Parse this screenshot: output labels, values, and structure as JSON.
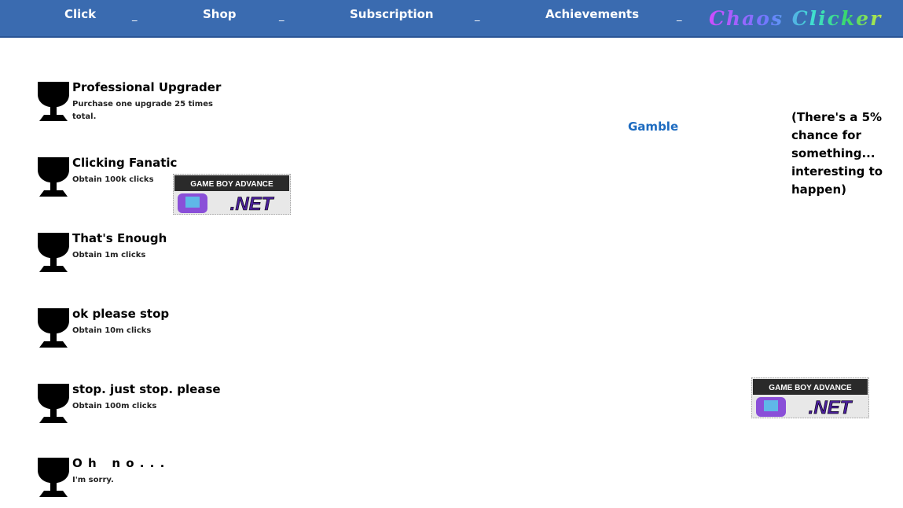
{
  "nav": {
    "click": "Click",
    "shop": "Shop",
    "subscription": "Subscription",
    "achievements": "Achievements",
    "separator": "_",
    "brand": "Chaos Clicker"
  },
  "achievements": [
    {
      "title": "Professional Upgrader",
      "desc": "Purchase one upgrade 25 times total."
    },
    {
      "title": "Clicking Fanatic",
      "desc": "Obtain 100k clicks"
    },
    {
      "title": "That's Enough",
      "desc": "Obtain 1m clicks"
    },
    {
      "title": "ok please stop",
      "desc": "Obtain 10m clicks"
    },
    {
      "title": "stop. just stop. please",
      "desc": "Obtain 100m clicks"
    },
    {
      "title": "O h   n o . . .",
      "desc": "I'm sorry."
    }
  ],
  "gamble": {
    "label": "Gamble",
    "note": "(There's a 5% chance for something... interesting to happen)"
  },
  "badge": {
    "line1": "GAME BOY ADVANCE",
    "line2": ".NET"
  }
}
